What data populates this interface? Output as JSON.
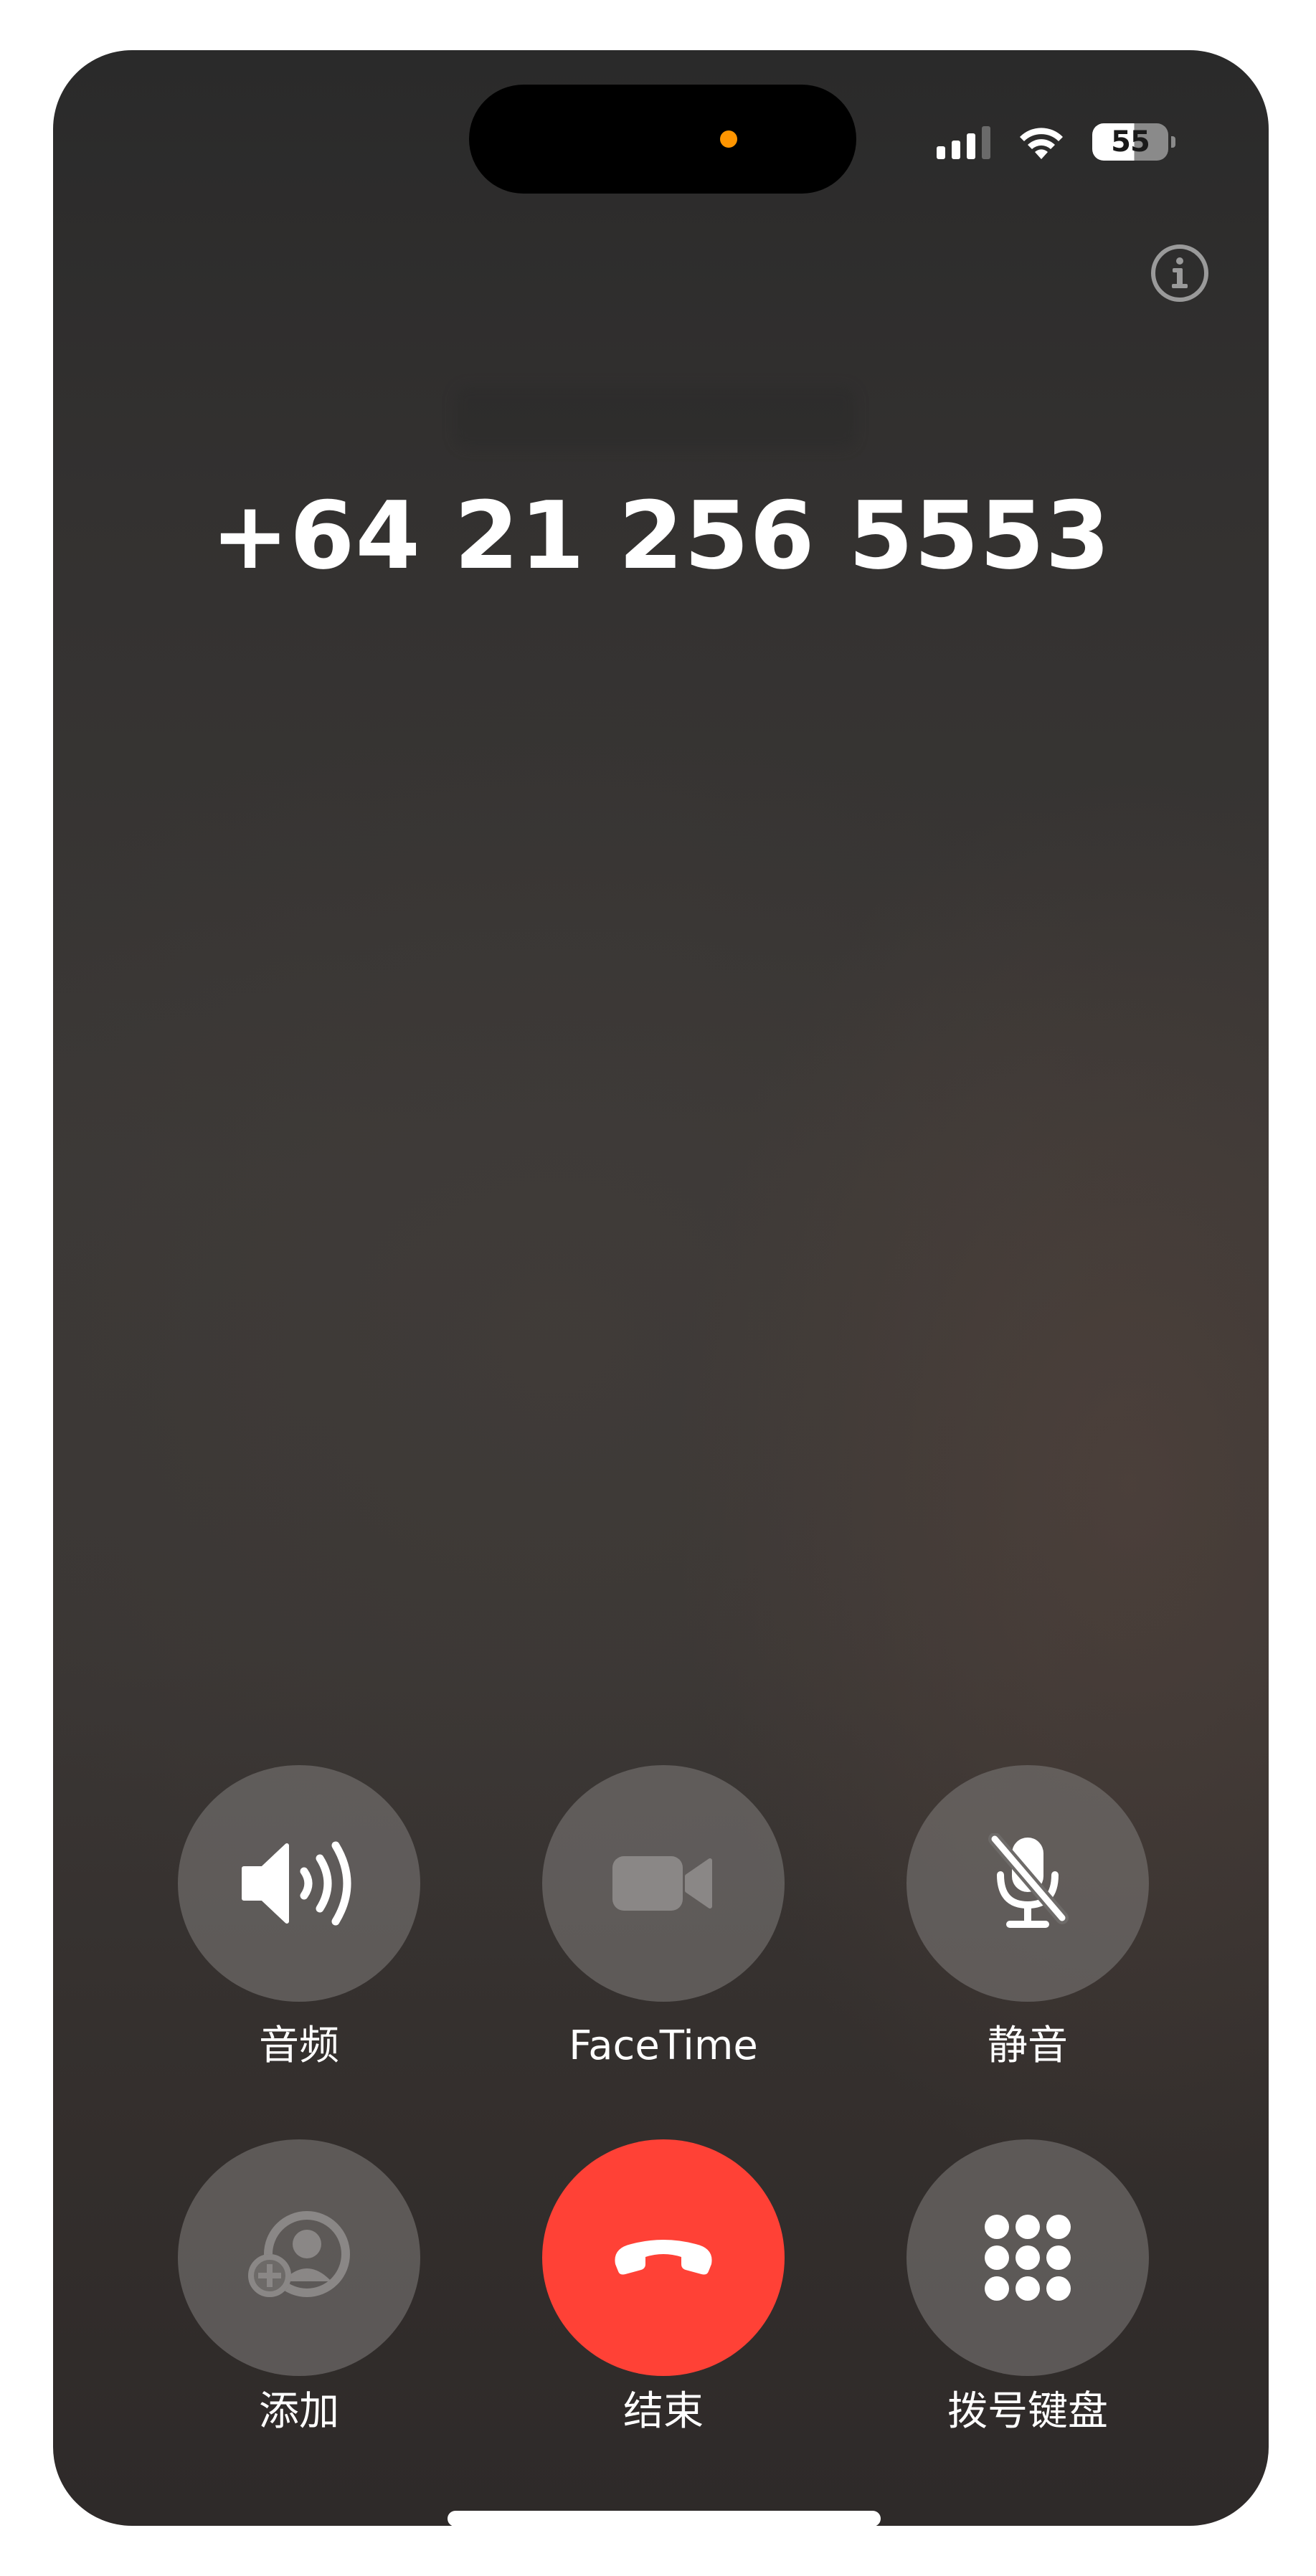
{
  "status_bar": {
    "battery_level": "55",
    "signal_bars": 3,
    "recording_indicator_color": "#ff9500"
  },
  "header": {
    "info_icon": "info-circle-icon",
    "phone_number": "+64 21 256 5553"
  },
  "controls": {
    "row1": [
      {
        "id": "audio",
        "label": "音频",
        "icon": "speaker-wave-icon"
      },
      {
        "id": "facetime",
        "label": "FaceTime",
        "icon": "video-camera-icon"
      },
      {
        "id": "mute",
        "label": "静音",
        "icon": "microphone-slash-icon"
      }
    ],
    "row2": [
      {
        "id": "add",
        "label": "添加",
        "icon": "add-person-icon"
      },
      {
        "id": "end",
        "label": "结束",
        "icon": "phone-hangup-icon"
      },
      {
        "id": "keypad",
        "label": "拨号键盘",
        "icon": "keypad-icon"
      }
    ]
  },
  "colors": {
    "end_button": "#ff4136",
    "control_button": "#78757290"
  }
}
